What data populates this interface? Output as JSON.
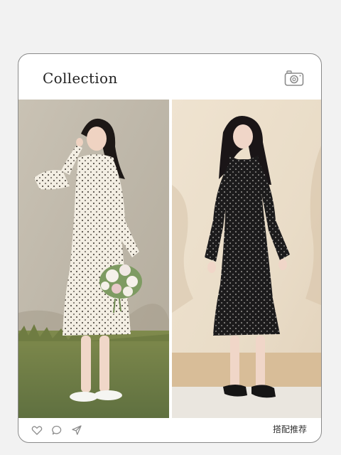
{
  "card": {
    "title": "Collection",
    "footer_label": "搭配推荐"
  },
  "icons": {
    "camera": "camera-icon",
    "like": "heart-icon",
    "comment": "comment-icon",
    "share": "send-icon"
  },
  "colors": {
    "page_bg": "#f2f2f2",
    "card_bg": "#ffffff",
    "card_border": "#8a8a8a",
    "icon_stroke": "#8c8c8c"
  }
}
